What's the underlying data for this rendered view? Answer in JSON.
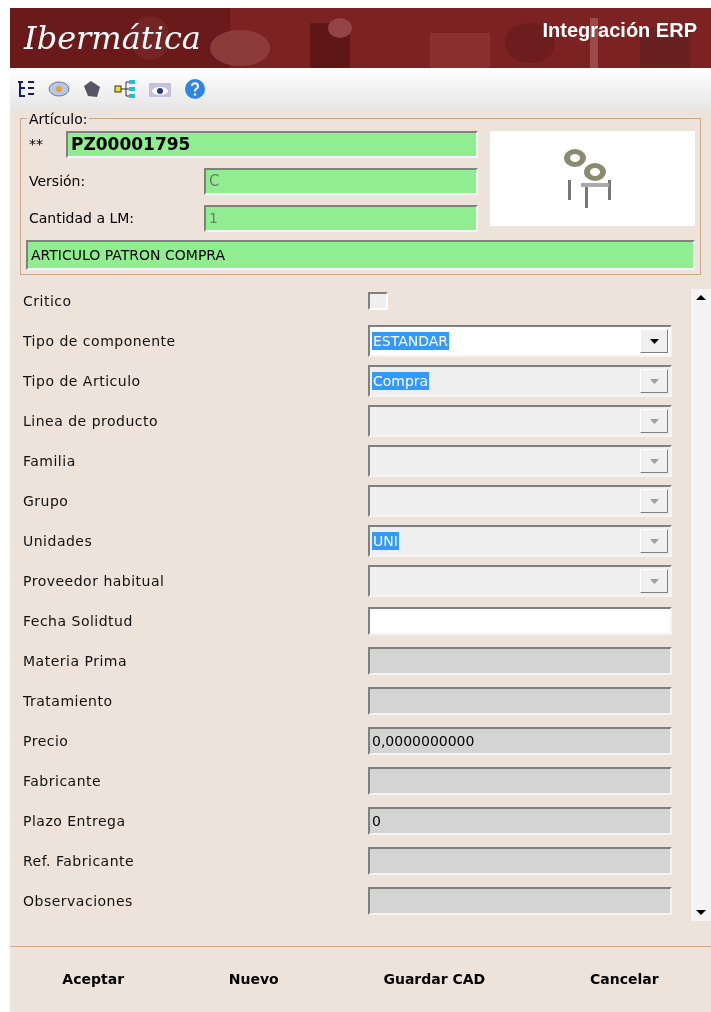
{
  "header": {
    "logo": "Ibermática",
    "title": "Integración ERP"
  },
  "article": {
    "legend": "Artículo:",
    "code_prefix": "**",
    "code": "PZ00001795",
    "version_label": "Versión:",
    "version": "C",
    "quantity_label": "Cantidad a LM:",
    "quantity": "1",
    "description": "ARTICULO PATRON COMPRA"
  },
  "fields": [
    {
      "label": "Critico",
      "kind": "checkbox",
      "checked": false
    },
    {
      "label": "Tipo de componente",
      "kind": "combo",
      "disabled": false,
      "value": "ESTANDAR",
      "highlighted": true
    },
    {
      "label": "Tipo de Articulo",
      "kind": "combo",
      "disabled": true,
      "value": "Compra",
      "highlighted": true
    },
    {
      "label": "Linea de producto",
      "kind": "combo",
      "disabled": true
    },
    {
      "label": "Familia",
      "kind": "combo",
      "disabled": true
    },
    {
      "label": "Grupo",
      "kind": "combo",
      "disabled": true
    },
    {
      "label": "Unidades",
      "kind": "combo",
      "disabled": true,
      "value": "UNI",
      "highlighted": true
    },
    {
      "label": "Proveedor habitual",
      "kind": "combo",
      "disabled": true
    },
    {
      "label": "Fecha Solidtud",
      "kind": "text",
      "disabled": false
    },
    {
      "label": "Materia Prima",
      "kind": "text",
      "disabled": true
    },
    {
      "label": "Tratamiento",
      "kind": "text",
      "disabled": true
    },
    {
      "label": "Precio",
      "kind": "text",
      "disabled": true,
      "value": "0,0000000000"
    },
    {
      "label": "Fabricante",
      "kind": "text",
      "disabled": true
    },
    {
      "label": "Plazo Entrega",
      "kind": "text",
      "disabled": true,
      "value": "0"
    },
    {
      "label": "Ref. Fabricante",
      "kind": "text",
      "disabled": true
    },
    {
      "label": "Observaciones",
      "kind": "text",
      "disabled": true
    }
  ],
  "buttons": [
    "Aceptar",
    "Nuevo",
    "Guardar CAD",
    "Cancelar"
  ]
}
